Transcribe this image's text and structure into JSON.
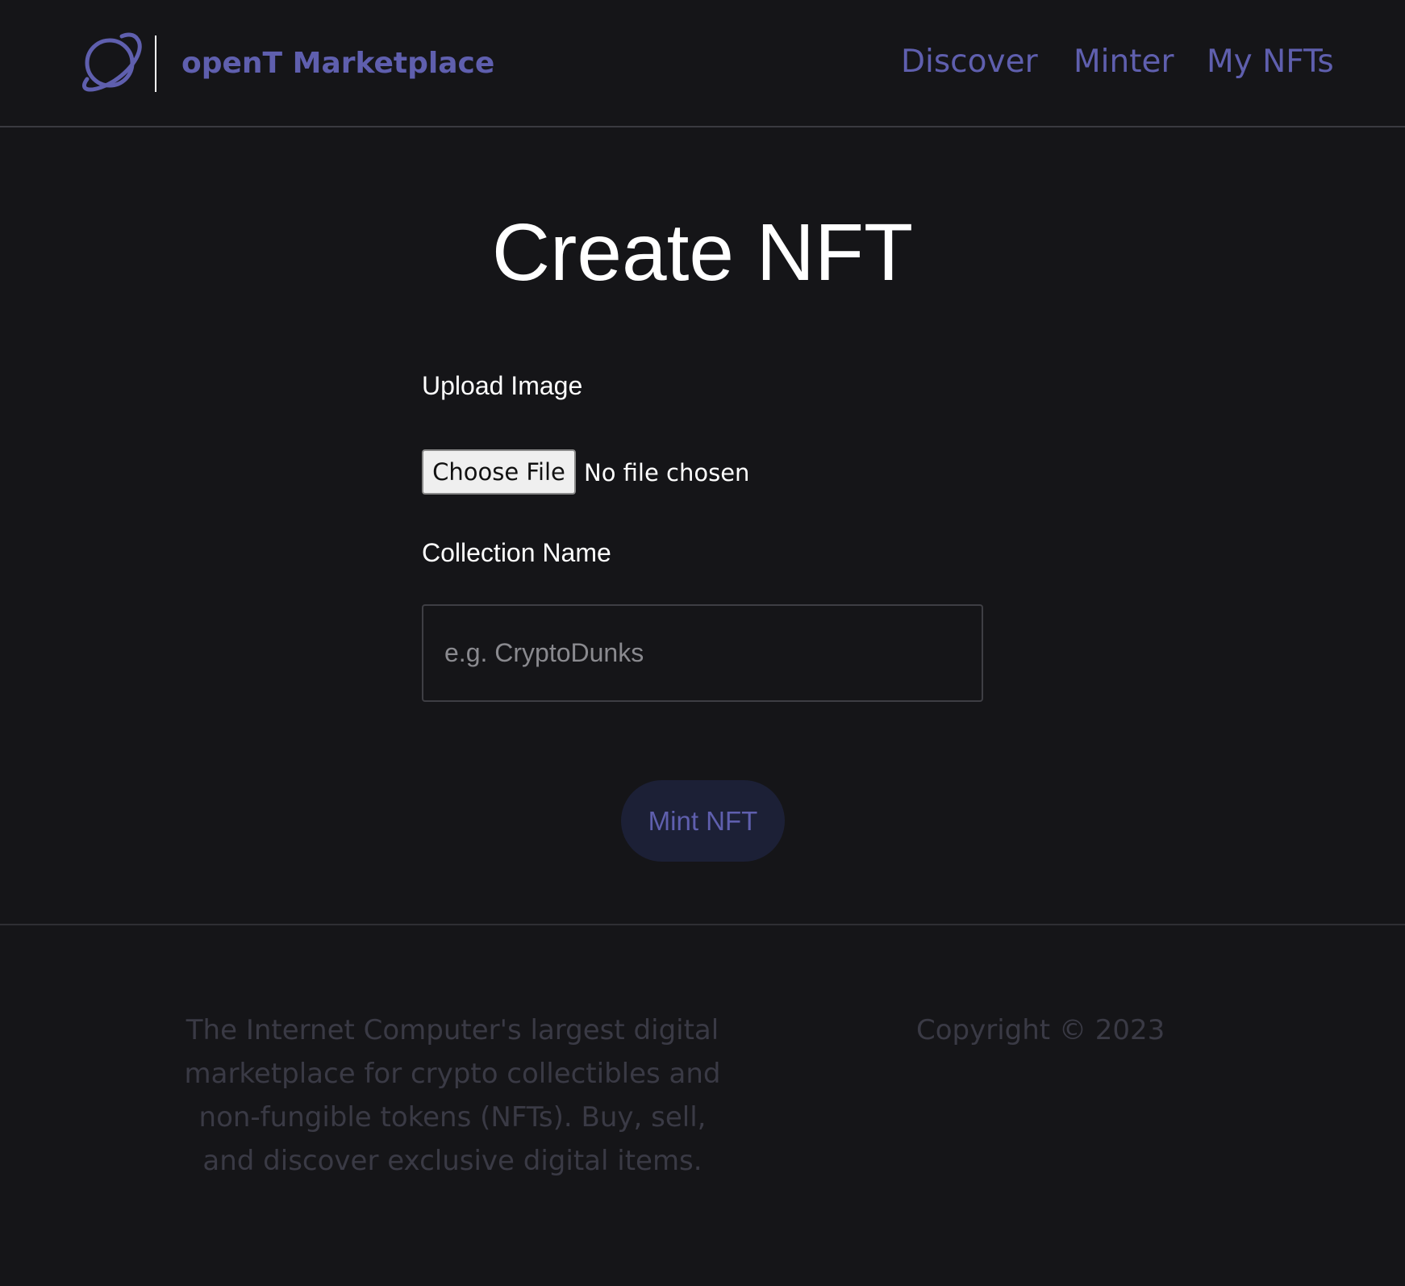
{
  "header": {
    "brand": "openT Marketplace",
    "logo_icon": "planet-icon",
    "nav": {
      "discover": "Discover",
      "minter": "Minter",
      "my_nfts": "My NFTs"
    }
  },
  "main": {
    "title": "Create NFT",
    "upload_label": "Upload Image",
    "file_button": "Choose File",
    "file_status": "No file chosen",
    "collection_label": "Collection Name",
    "collection_value": "",
    "collection_placeholder": "e.g. CryptoDunks",
    "mint_button": "Mint NFT"
  },
  "footer": {
    "description": "The Internet Computer's largest digital marketplace for crypto collectibles and non-fungible tokens (NFTs). Buy, sell, and discover exclusive digital items.",
    "copyright": "Copyright © 2023"
  },
  "colors": {
    "background": "#151518",
    "accent": "#5f5fae",
    "button_bg": "#1c2036",
    "footer_text": "#3a3a45"
  }
}
